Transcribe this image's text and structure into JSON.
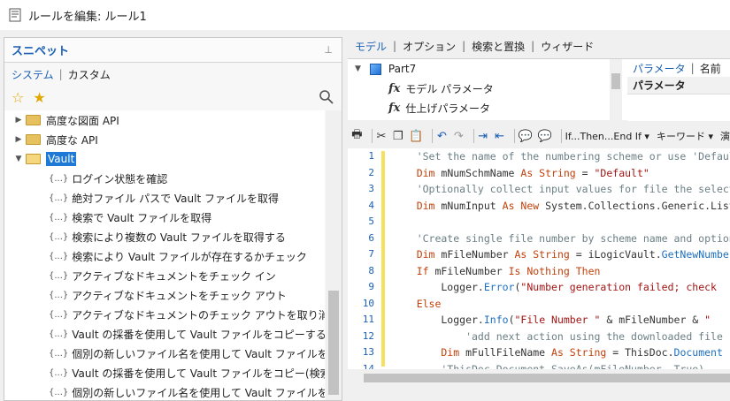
{
  "window": {
    "title": "ルールを編集: ルール1"
  },
  "snippets": {
    "title": "スニペット",
    "pin": "⊥",
    "tabs": [
      "システム",
      "カスタム"
    ],
    "tree": [
      {
        "kind": "folder",
        "label": "高度な図面 API",
        "expanded": false
      },
      {
        "kind": "folder",
        "label": "高度な API",
        "expanded": false
      },
      {
        "kind": "folder",
        "label": "Vault",
        "expanded": true,
        "selected": true
      },
      {
        "kind": "snippet",
        "label": "ログイン状態を確認"
      },
      {
        "kind": "snippet",
        "label": "絶対ファイル パスで Vault ファイルを取得"
      },
      {
        "kind": "snippet",
        "label": "検索で Vault ファイルを取得"
      },
      {
        "kind": "snippet",
        "label": "検索により複数の Vault ファイルを取得する"
      },
      {
        "kind": "snippet",
        "label": "検索により Vault ファイルが存在するかチェック"
      },
      {
        "kind": "snippet",
        "label": "アクティブなドキュメントをチェック イン"
      },
      {
        "kind": "snippet",
        "label": "アクティブなドキュメントをチェック アウト"
      },
      {
        "kind": "snippet",
        "label": "アクティブなドキュメントのチェック アウトを取り消し"
      },
      {
        "kind": "snippet",
        "label": "Vault の採番を使用して Vault ファイルをコピーする"
      },
      {
        "kind": "snippet",
        "label": "個別の新しいファイル名を使用して Vault ファイルをコピーする"
      },
      {
        "kind": "snippet",
        "label": "Vault の採番を使用して Vault ファイルをコピー(検索)する"
      },
      {
        "kind": "snippet",
        "label": "個別の新しいファイル名を使用して Vault ファイルをコピー(検索"
      }
    ],
    "snippet_badge": "{...}"
  },
  "editor": {
    "tabs": [
      "モデル",
      "オプション",
      "検索と置換",
      "ウィザード"
    ],
    "model_tree": [
      {
        "label": "Part7",
        "icon": "part-icon"
      },
      {
        "label": "モデル パラメータ",
        "icon": "fx-icon"
      },
      {
        "label": "仕上げパラメータ",
        "icon": "fx-icon"
      }
    ],
    "params_tabs": [
      "パラメータ",
      "名前"
    ],
    "params_header": "パラメータ",
    "toolbar": {
      "if_label": "If...Then...End If",
      "keyword_label": "キーワード",
      "extra_label": "演"
    },
    "code_lines": [
      {
        "n": "1",
        "tokens": [
          [
            "cm",
            "    'Set the name of the numbering scheme or use 'Default'"
          ]
        ]
      },
      {
        "n": "2",
        "tokens": [
          [
            "kw",
            "    Dim "
          ],
          [
            "tx",
            "mNumSchmName "
          ],
          [
            "kw",
            "As String"
          ],
          [
            "tx",
            " = "
          ],
          [
            "st",
            "\"Default\""
          ]
        ]
      },
      {
        "n": "3",
        "tokens": [
          [
            "cm",
            "    'Optionally collect input values for file the selected scheme"
          ]
        ]
      },
      {
        "n": "4",
        "tokens": [
          [
            "kw",
            "    Dim "
          ],
          [
            "tx",
            "mNumInput "
          ],
          [
            "kw",
            "As New "
          ],
          [
            "tx",
            "System.Collections.Generic.List"
          ]
        ]
      },
      {
        "n": "5",
        "tokens": [
          [
            "tx",
            ""
          ]
        ]
      },
      {
        "n": "6",
        "tokens": [
          [
            "cm",
            "    'Create single file number by scheme name and optional input"
          ]
        ]
      },
      {
        "n": "7",
        "tokens": [
          [
            "kw",
            "    Dim "
          ],
          [
            "tx",
            "mFileNumber "
          ],
          [
            "kw",
            "As String"
          ],
          [
            "tx",
            " = iLogicVault."
          ],
          [
            "fn",
            "GetNewNumber"
          ]
        ]
      },
      {
        "n": "8",
        "tokens": [
          [
            "kw",
            "    If "
          ],
          [
            "tx",
            "mFileNumber "
          ],
          [
            "kw",
            "Is Nothing Then"
          ]
        ]
      },
      {
        "n": "9",
        "tokens": [
          [
            "tx",
            "        Logger."
          ],
          [
            "fn",
            "Error"
          ],
          [
            "tx",
            "("
          ],
          [
            "st",
            "\"Number generation failed; check"
          ]
        ]
      },
      {
        "n": "10",
        "tokens": [
          [
            "kw",
            "    Else"
          ]
        ]
      },
      {
        "n": "11",
        "tokens": [
          [
            "tx",
            "        Logger."
          ],
          [
            "fn",
            "Info"
          ],
          [
            "tx",
            "("
          ],
          [
            "st",
            "\"File Number \""
          ],
          [
            "tx",
            " & mFileNumber & "
          ],
          [
            "st",
            "\" "
          ]
        ]
      },
      {
        "n": "12",
        "tokens": [
          [
            "cm",
            "            'add next action using the downloaded file"
          ]
        ]
      },
      {
        "n": "13",
        "tokens": [
          [
            "kw",
            "        Dim "
          ],
          [
            "tx",
            "mFullFileName "
          ],
          [
            "kw",
            "As String"
          ],
          [
            "tx",
            " = ThisDoc."
          ],
          [
            "fn",
            "Document"
          ]
        ]
      },
      {
        "n": "14",
        "tokens": [
          [
            "cm",
            "        'ThisDoc.Document.SaveAs(mFileNumber, True)"
          ]
        ]
      }
    ]
  }
}
